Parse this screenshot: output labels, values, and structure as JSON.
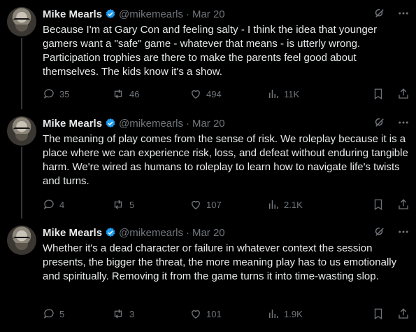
{
  "colors": {
    "background": "#000000",
    "text_primary": "#e7e9ea",
    "text_secondary": "#71767b",
    "verified_blue": "#1d9bf0",
    "thread_line": "#333639"
  },
  "tweets": [
    {
      "name": "Mike Mearls",
      "handle": "@mikemearls",
      "separator": "·",
      "time": "Mar 20",
      "text": "Because I'm at Gary Con and feeling salty - I think the idea that younger gamers want a \"safe\" game - whatever that means - is utterly wrong. Participation trophies are there to make the parents feel good about themselves. The kids know it's a show.",
      "replies": "35",
      "reposts": "46",
      "likes": "494",
      "views": "11K",
      "icons": [
        "grok-icon",
        "more-icon",
        "reply-icon",
        "repost-icon",
        "like-icon",
        "views-icon",
        "bookmark-icon",
        "share-icon"
      ]
    },
    {
      "name": "Mike Mearls",
      "handle": "@mikemearls",
      "separator": "·",
      "time": "Mar 20",
      "text": "The meaning of play comes from the sense of risk. We roleplay because it is a place where we can experience risk, loss, and defeat without enduring tangible harm. We're wired as humans to roleplay to learn how to navigate life's twists and turns.",
      "replies": "4",
      "reposts": "5",
      "likes": "107",
      "views": "2.1K"
    },
    {
      "name": "Mike Mearls",
      "handle": "@mikemearls",
      "separator": "·",
      "time": "Mar 20",
      "text": "Whether it's a dead character or failure in whatever context the session presents, the bigger the threat, the more meaning play has to us emotionally and spiritually. Removing it from the game turns it into time-wasting slop.",
      "replies": "5",
      "reposts": "3",
      "likes": "101",
      "views": "1.9K"
    }
  ]
}
